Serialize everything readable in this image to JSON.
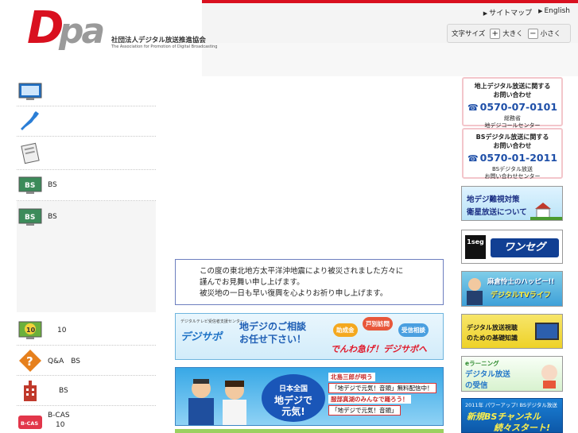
{
  "header": {
    "logo": "Dpa",
    "org_name_jp": "社団法人デジタル放送推進協会",
    "org_name_en": "The Association for Promotion of Digital Broadcasting",
    "sitemap": "サイトマップ",
    "english": "English",
    "font_size_label": "文字サイズ",
    "font_larger": "大きく",
    "font_smaller": "小さく",
    "accent_color": "#d9101f"
  },
  "left_nav": {
    "items": [
      {
        "icon": "tv-icon",
        "label": ""
      },
      {
        "icon": "japan-map-icon",
        "label": ""
      },
      {
        "icon": "document-icon",
        "label": ""
      },
      {
        "icon": "bs-tv-icon",
        "label": "BS"
      },
      {
        "icon": "bs-tv-icon",
        "label": "BS"
      },
      {
        "icon": "tv-10-icon",
        "label": "10"
      },
      {
        "icon": "question-icon",
        "label": "Q&A　BS"
      },
      {
        "icon": "building-icon",
        "label": "BS"
      },
      {
        "icon": "bcas-card-icon",
        "label": "B-CAS",
        "sub": "10"
      }
    ]
  },
  "notice": {
    "line1": "この度の東北地方太平洋沖地震により被災されました方々に",
    "line2": "謹んでお見舞い申し上げます。",
    "line3": "被災地の一日も早い復興を心よりお祈り申し上げます。"
  },
  "banner_digisapo": {
    "sub": "デジタルテレビ受信者支援センター",
    "logo": "デジサポ",
    "main1": "地デジのご相談",
    "main2": "お任せ下さい！",
    "badge1": "助成金",
    "badge2": "戸別訪問",
    "badge3": "受信相談",
    "cta": "でんわ急げ！デジサポへ"
  },
  "banner_genki": {
    "center1": "日本全国",
    "center2": "地デジで",
    "center3": "元気!",
    "r1": "北島三郎が唄う",
    "r2": "「地デジで元気！音頭」無料配信中！",
    "r3": "服部真湖のみんなで踊ろう！",
    "r4": "「地デジで元気！音頭」"
  },
  "contacts": [
    {
      "title1": "地上デジタル放送に関する",
      "title2": "お問い合わせ",
      "phone": "0570-07-0101",
      "foot1": "総務省",
      "foot2": "地デジコールセンター"
    },
    {
      "title1": "BSデジタル放送に関する",
      "title2": "お問い合わせ",
      "phone": "0570-01-2011",
      "foot1": "BSデジタル放送",
      "foot2": "お問い合わせセンター"
    }
  ],
  "right_banners": {
    "nanchou1": "地デジ難視対策",
    "nanchou2": "衛星放送について",
    "oneseg_box": "1seg",
    "oneseg": "ワンセグ",
    "happy1": "麻倉怜士のハッピー!!",
    "happy2": "デジタルTVライフ",
    "kiso1": "デジタル放送視聴",
    "kiso2": "のための基礎知識",
    "elearn0": "eラーニング",
    "elearn1": "デジタル放送",
    "elearn2": "の受信",
    "newbs0": "2011年 パワーアップ! BSデジタル放送",
    "newbs1": "新規BSチャンネル",
    "newbs2": "続々スタート!"
  }
}
